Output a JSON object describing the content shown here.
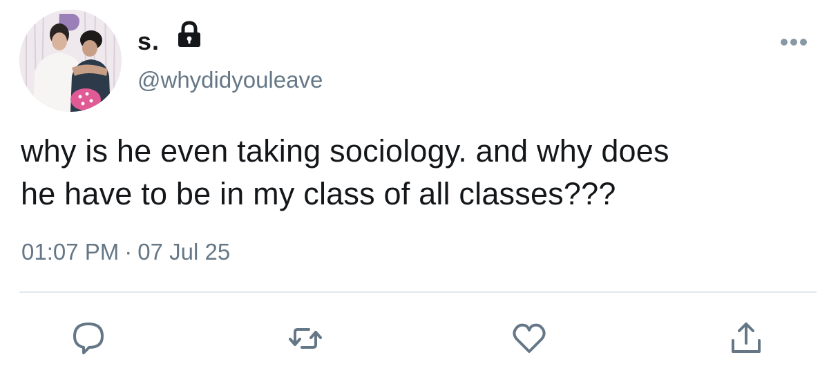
{
  "user": {
    "display_name": "s.",
    "handle": "@whydidyouleave",
    "protected_icon": "lock-icon",
    "avatar_icon": "profile-photo"
  },
  "tweet": {
    "text": "why is he even taking sociology. and why does\nhe have to be in my class of all classes???",
    "time": "01:07 PM",
    "separator": "·",
    "date": "07 Jul 25"
  },
  "actions": {
    "reply_icon": "reply-icon",
    "retweet_icon": "retweet-icon",
    "like_icon": "heart-icon",
    "share_icon": "share-icon",
    "more_icon": "more-options-icon"
  },
  "colors": {
    "text": "#14171a",
    "secondary": "#657786",
    "divider": "#e1e8ed",
    "icon": "#657786"
  }
}
